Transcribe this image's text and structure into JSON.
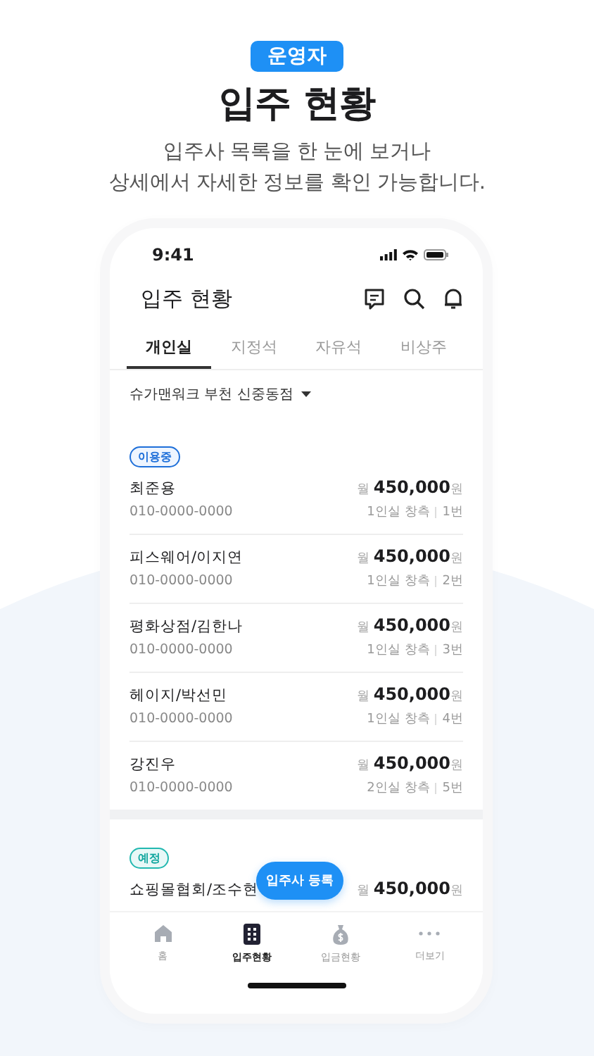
{
  "badge": "운영자",
  "title": "입주 현황",
  "subtitle": [
    "입주사 목록을 한 눈에 보거나",
    "상세에서 자세한 정보를 확인 가능합니다."
  ],
  "phone": {
    "status_bar": {
      "time": "9:41"
    },
    "header": {
      "title": "입주 현황"
    },
    "tabs": [
      {
        "label": "개인실",
        "selected": true
      },
      {
        "label": "지정석",
        "selected": false
      },
      {
        "label": "자유석",
        "selected": false
      },
      {
        "label": "비상주",
        "selected": false
      }
    ],
    "branch": "슈가맨워크 부천 신중동점",
    "sections": [
      {
        "tenants": [
          {
            "status": {
              "kind": "in_use",
              "label": "이용중"
            },
            "name": "최준용",
            "phone": "010-0000-0000",
            "price_prefix": "월",
            "price": "450,000",
            "price_unit": "원",
            "room": "1인실 창측",
            "seat": "1번"
          },
          {
            "name": "피스웨어/이지연",
            "phone": "010-0000-0000",
            "price_prefix": "월",
            "price": "450,000",
            "price_unit": "원",
            "room": "1인실 창측",
            "seat": "2번"
          },
          {
            "name": "평화상점/김한나",
            "phone": "010-0000-0000",
            "price_prefix": "월",
            "price": "450,000",
            "price_unit": "원",
            "room": "1인실 창측",
            "seat": "3번"
          },
          {
            "name": "헤이지/박선민",
            "phone": "010-0000-0000",
            "price_prefix": "월",
            "price": "450,000",
            "price_unit": "원",
            "room": "1인실 창측",
            "seat": "4번"
          },
          {
            "name": "강진우",
            "phone": "010-0000-0000",
            "price_prefix": "월",
            "price": "450,000",
            "price_unit": "원",
            "room": "2인실 창측",
            "seat": "5번"
          }
        ]
      },
      {
        "tenants": [
          {
            "status": {
              "kind": "scheduled",
              "label": "예정"
            },
            "name": "쇼핑몰협회/조수현",
            "price_prefix": "월",
            "price": "450,000",
            "price_unit": "원"
          }
        ]
      }
    ],
    "fab": "입주사 등록",
    "bottom_nav": [
      {
        "label": "홈",
        "selected": false
      },
      {
        "label": "입주현황",
        "selected": true
      },
      {
        "label": "입금현황",
        "selected": false
      },
      {
        "label": "더보기",
        "selected": false
      }
    ]
  }
}
